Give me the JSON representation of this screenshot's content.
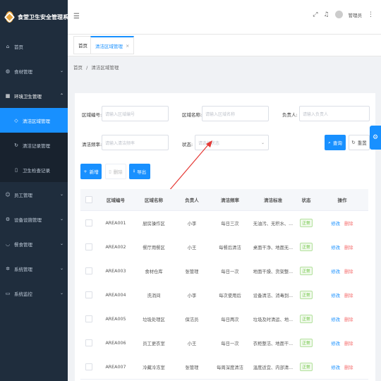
{
  "app": {
    "title": "食堂卫生安全管理系统"
  },
  "sidebar": {
    "items": [
      {
        "label": "首页",
        "icon": "home-icon"
      },
      {
        "label": "食材管理",
        "icon": "apple-icon"
      },
      {
        "label": "环境卫生管理",
        "icon": "grid-icon",
        "open": true
      },
      {
        "label": "员工管理",
        "icon": "user-icon"
      },
      {
        "label": "设备设施管理",
        "icon": "gear-icon"
      },
      {
        "label": "餐食管理",
        "icon": "bowl-icon"
      },
      {
        "label": "系统管理",
        "icon": "settings-icon"
      },
      {
        "label": "系统监控",
        "icon": "monitor-icon"
      }
    ],
    "submenu": [
      {
        "label": "清洁区域管理",
        "active": true
      },
      {
        "label": "清洁记录管理"
      },
      {
        "label": "卫生检查记录"
      }
    ]
  },
  "header": {
    "username": "管理员"
  },
  "tabs": [
    {
      "label": "首页"
    },
    {
      "label": "清洁区域管理",
      "close": "×",
      "active": true
    }
  ],
  "breadcrumb": {
    "home": "首页",
    "sep": "/",
    "current": "清洁区域管理"
  },
  "search": {
    "area_code_label": "区域编号:",
    "area_code_placeholder": "请输入区域编号",
    "area_name_label": "区域名称:",
    "area_name_placeholder": "请输入区域名称",
    "owner_label": "负责人:",
    "owner_placeholder": "请输入负责人",
    "freq_label": "清洁频率:",
    "freq_placeholder": "请输入清洁频率",
    "status_label": "状态:",
    "status_placeholder": "请选择状态",
    "query_label": "查询",
    "reset_label": "重置"
  },
  "toolbar": {
    "add_label": "新增",
    "delete_label": "删除",
    "export_label": "导出"
  },
  "table": {
    "columns": [
      "区域编号",
      "区域名称",
      "负责人",
      "清洁频率",
      "清洁标准",
      "状态",
      "操作"
    ],
    "edit_label": "修改",
    "delete_label": "删除",
    "rows": [
      {
        "code": "AREA001",
        "name": "厨房操作区",
        "owner": "小李",
        "freq": "每日三次",
        "standard": "无油污、无积水、...",
        "status": "正常"
      },
      {
        "code": "AREA002",
        "name": "餐厅用餐区",
        "owner": "小王",
        "freq": "每餐后清洁",
        "standard": "桌面干净、地面无...",
        "status": "正常"
      },
      {
        "code": "AREA003",
        "name": "食材仓库",
        "owner": "张管理",
        "freq": "每日一次",
        "standard": "地面干燥、货架整...",
        "status": "正常"
      },
      {
        "code": "AREA004",
        "name": "洗消间",
        "owner": "小李",
        "freq": "每次使用后",
        "standard": "设备清洁、消毒到...",
        "status": "正常"
      },
      {
        "code": "AREA005",
        "name": "垃圾处理区",
        "owner": "保洁员",
        "freq": "每日两次",
        "standard": "垃圾及时清运、地...",
        "status": "正常"
      },
      {
        "code": "AREA006",
        "name": "员工更衣室",
        "owner": "小王",
        "freq": "每日一次",
        "standard": "衣柜整洁、地面干...",
        "status": "正常"
      },
      {
        "code": "AREA007",
        "name": "冷藏冷冻室",
        "owner": "张管理",
        "freq": "每周深度清洁",
        "standard": "温度适宜、内部清...",
        "status": "正常"
      }
    ]
  },
  "colors": {
    "primary": "#1890ff",
    "sidebar_bg": "#1f2d3d",
    "success": "#67c23a",
    "danger": "#f56c6c",
    "annotation": "#e53935"
  }
}
